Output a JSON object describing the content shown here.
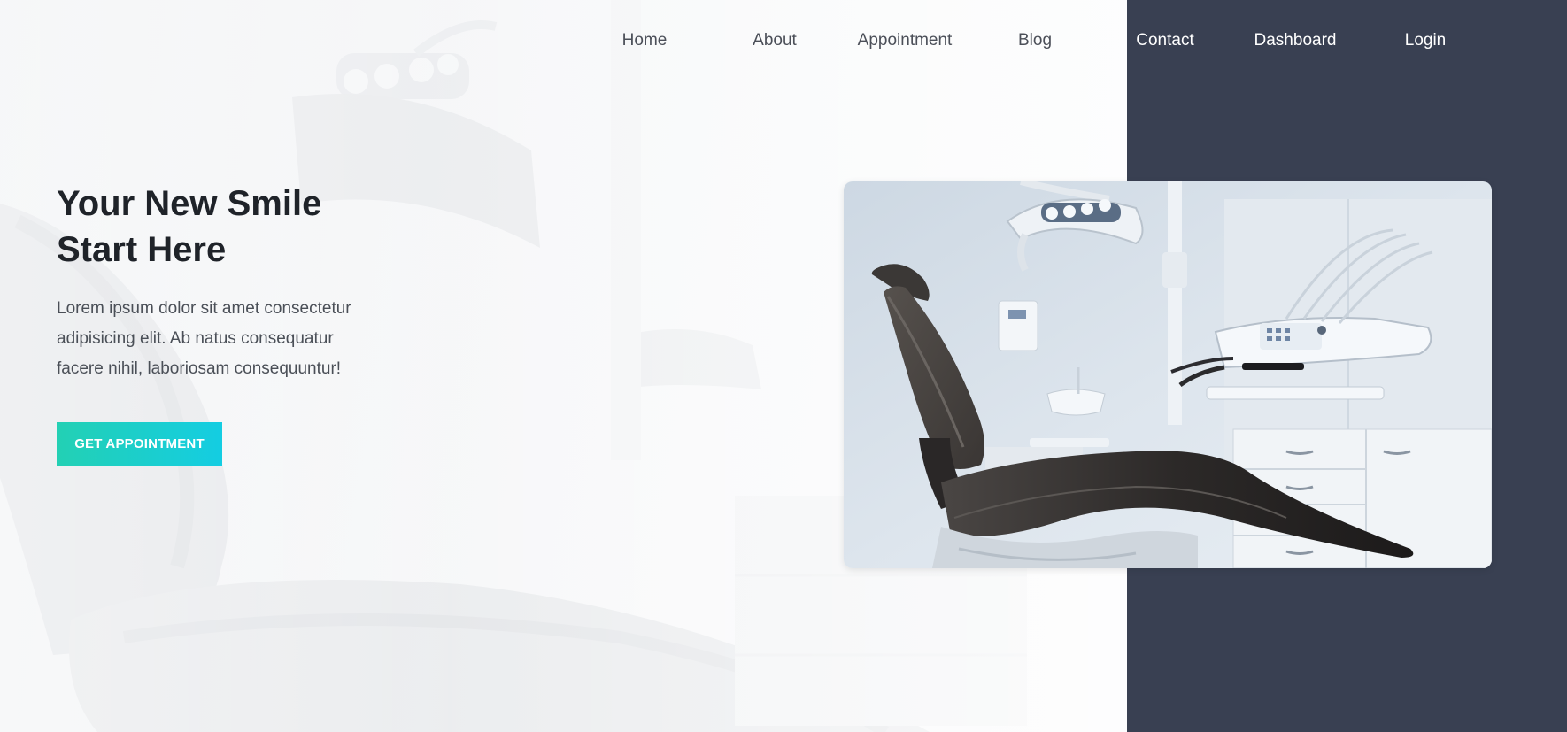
{
  "nav": {
    "items": [
      {
        "label": "Home"
      },
      {
        "label": "About"
      },
      {
        "label": "Appointment"
      },
      {
        "label": "Blog"
      },
      {
        "label": "Contact"
      },
      {
        "label": "Dashboard"
      },
      {
        "label": "Login"
      }
    ]
  },
  "hero": {
    "title_line1": "Your New Smile",
    "title_line2": "Start Here",
    "text_line1": "Lorem ipsum dolor sit amet consectetur",
    "text_line2": "adipisicing elit. Ab natus consequatur",
    "text_line3": "facere nihil, laboriosam consequuntur!",
    "cta_label": "GET APPOINTMENT"
  },
  "colors": {
    "dark_panel": "#394052",
    "accent_start": "#23d0b4",
    "accent_end": "#14cde2",
    "heading": "#1f2329"
  }
}
